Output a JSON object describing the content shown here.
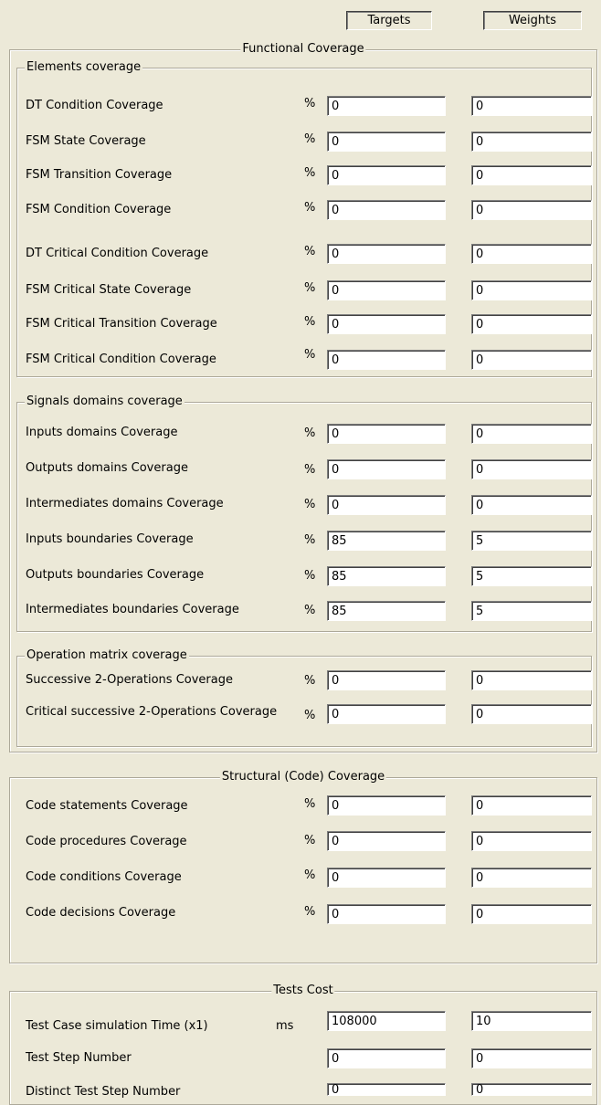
{
  "header": {
    "targets_label": "Targets",
    "weights_label": "Weights"
  },
  "functional": {
    "title": "Functional Coverage",
    "elements": {
      "title": "Elements coverage",
      "rows": [
        {
          "label": "DT Condition Coverage",
          "unit": "%",
          "target": "0",
          "weight": "0"
        },
        {
          "label": "FSM State Coverage",
          "unit": "%",
          "target": "0",
          "weight": "0"
        },
        {
          "label": "FSM Transition Coverage",
          "unit": "%",
          "target": "0",
          "weight": "0"
        },
        {
          "label": "FSM Condition Coverage",
          "unit": "%",
          "target": "0",
          "weight": "0"
        },
        {
          "label": "DT Critical Condition Coverage",
          "unit": "%",
          "target": "0",
          "weight": "0"
        },
        {
          "label": "FSM Critical State Coverage",
          "unit": "%",
          "target": "0",
          "weight": "0"
        },
        {
          "label": "FSM Critical Transition Coverage",
          "unit": "%",
          "target": "0",
          "weight": "0"
        },
        {
          "label": "FSM Critical Condition Coverage",
          "unit": "%",
          "target": "0",
          "weight": "0"
        }
      ]
    },
    "signals": {
      "title": "Signals domains coverage",
      "rows": [
        {
          "label": "Inputs domains Coverage",
          "unit": "%",
          "target": "0",
          "weight": "0"
        },
        {
          "label": "Outputs domains Coverage",
          "unit": "%",
          "target": "0",
          "weight": "0"
        },
        {
          "label": "Intermediates domains Coverage",
          "unit": "%",
          "target": "0",
          "weight": "0"
        },
        {
          "label": "Inputs boundaries Coverage",
          "unit": "%",
          "target": "85",
          "weight": "5"
        },
        {
          "label": "Outputs boundaries Coverage",
          "unit": "%",
          "target": "85",
          "weight": "5"
        },
        {
          "label": "Intermediates boundaries Coverage",
          "unit": "%",
          "target": "85",
          "weight": "5"
        }
      ]
    },
    "operation": {
      "title": "Operation matrix coverage",
      "rows": [
        {
          "label": "Successive 2-Operations Coverage",
          "unit": "%",
          "target": "0",
          "weight": "0"
        },
        {
          "label": "Critical successive 2-Operations Coverage",
          "unit": "%",
          "target": "0",
          "weight": "0"
        }
      ]
    }
  },
  "structural": {
    "title": "Structural (Code) Coverage",
    "rows": [
      {
        "label": "Code statements Coverage",
        "unit": "%",
        "target": "0",
        "weight": "0"
      },
      {
        "label": "Code procedures Coverage",
        "unit": "%",
        "target": "0",
        "weight": "0"
      },
      {
        "label": "Code conditions Coverage",
        "unit": "%",
        "target": "0",
        "weight": "0"
      },
      {
        "label": "Code decisions Coverage",
        "unit": "%",
        "target": "0",
        "weight": "0"
      }
    ]
  },
  "cost": {
    "title": "Tests Cost",
    "rows": [
      {
        "label": "Test Case simulation Time (x1)",
        "unit": "ms",
        "target": "108000",
        "weight": "10"
      },
      {
        "label": "Test Step Number",
        "unit": "",
        "target": "0",
        "weight": "0"
      },
      {
        "label": "Distinct Test Step Number",
        "unit": "",
        "target": "0",
        "weight": "0"
      }
    ]
  }
}
